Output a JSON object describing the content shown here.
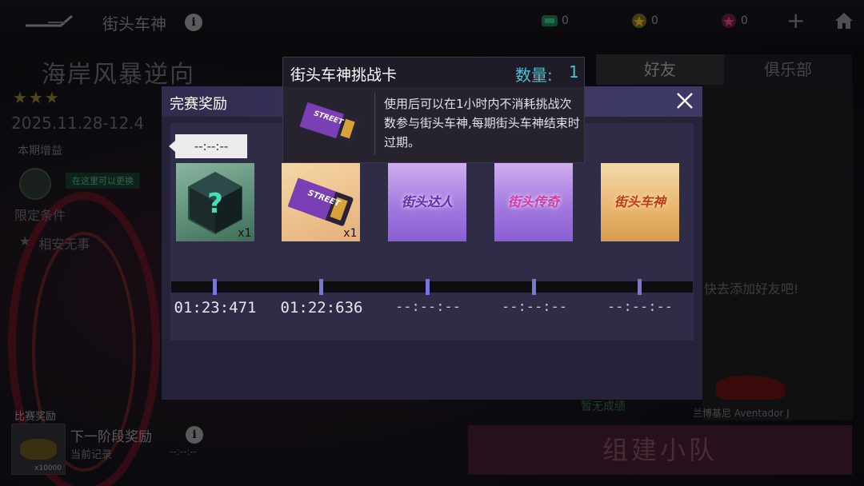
{
  "topbar": {
    "title": "街头车神",
    "currencies": [
      {
        "icon": "ticket-currency-icon",
        "value": "0",
        "color": "#2fae7a"
      },
      {
        "icon": "star-coin-icon",
        "value": "0",
        "color": "#c9a227"
      },
      {
        "icon": "gem-currency-icon",
        "value": "0",
        "color": "#c0396a"
      }
    ]
  },
  "event": {
    "title": "海岸风暴逆向",
    "stars": "★★★",
    "dates": "2025.11.28-12.4",
    "bonus_label": "本期增益",
    "change_hint": "在这里可以更换",
    "limit_label": "限定条件",
    "limit_value": "相安无事"
  },
  "social": {
    "tab_friends": "好友",
    "tab_club": "俱乐部",
    "add_friend_hint": "快去添加好友吧!",
    "no_result": "暂无成绩",
    "car_name": "兰博基尼 Aventador J"
  },
  "bottom": {
    "reward_label": "比赛奖励",
    "reward_qty": "x10000",
    "next_reward": "下一阶段奖励",
    "current_record": "当前记录",
    "record_value": "--:--:--",
    "build_team": "组建小队"
  },
  "modal": {
    "title": "完赛奖励",
    "current_time": "--:--:--",
    "rewards": [
      {
        "type": "mystery-box",
        "count": "x1",
        "time": "01:23:471"
      },
      {
        "type": "challenge-card",
        "count": "x1",
        "time": "01:22:636"
      },
      {
        "type": "title",
        "label": "街头达人",
        "time": "--:--:--"
      },
      {
        "type": "title",
        "label": "街头传奇",
        "time": "--:--:--"
      },
      {
        "type": "title",
        "label": "街头车神",
        "time": "--:--:--"
      }
    ]
  },
  "tooltip": {
    "title": "街头车神挑战卡",
    "qty_label": "数量:",
    "qty_value": "1",
    "description": "使用后可以在1小时内不消耗挑战次数参与街头车神,每期街头车神结束时过期。"
  }
}
